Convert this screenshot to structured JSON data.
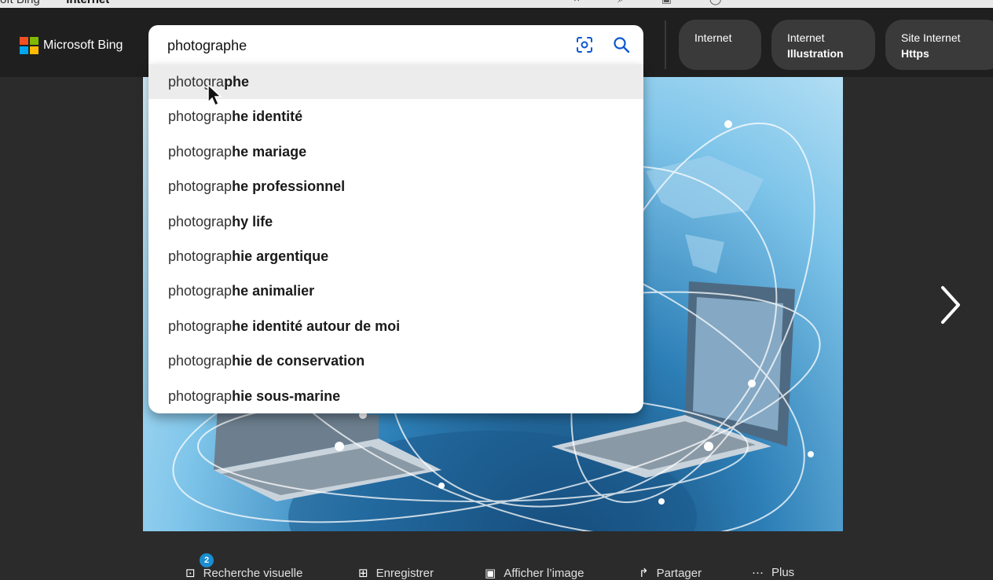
{
  "window": {
    "tab_title_prefix": "oft Bing",
    "tab_title_query": "internet"
  },
  "header": {
    "logo_text": "Microsoft Bing",
    "search": {
      "query": "photographe"
    },
    "chips": [
      {
        "line1": "Internet",
        "line2": ""
      },
      {
        "line1": "Internet",
        "line2": "Illustration"
      },
      {
        "line1": "Site Internet",
        "line2": "Https"
      }
    ]
  },
  "suggestions": [
    {
      "prefix": "photographe",
      "rest": "",
      "split": "photogra",
      "bold": "phe"
    },
    {
      "split": "photograp",
      "bold": "he identité"
    },
    {
      "split": "photograp",
      "bold": "he mariage"
    },
    {
      "split": "photograp",
      "bold": "he professionnel"
    },
    {
      "split": "photograp",
      "bold": "hy life"
    },
    {
      "split": "photograp",
      "bold": "hie argentique"
    },
    {
      "split": "photograp",
      "bold": "he animalier"
    },
    {
      "split": "photograp",
      "bold": "he identité autour de moi"
    },
    {
      "split": "photograp",
      "bold": "hie de conservation"
    },
    {
      "split": "photograp",
      "bold": "hie sous-marine"
    }
  ],
  "actions": {
    "visual_search": "Recherche visuelle",
    "visual_search_badge": "2",
    "save": "Enregistrer",
    "view_image": "Afficher l’image",
    "share": "Partager",
    "more": "Plus"
  },
  "colors": {
    "header_bg": "#1f1f1f",
    "page_bg": "#2b2b2b",
    "chip_bg": "#3a3a3a",
    "accent": "#1b8dd1",
    "search_icon": "#0b57d0"
  }
}
